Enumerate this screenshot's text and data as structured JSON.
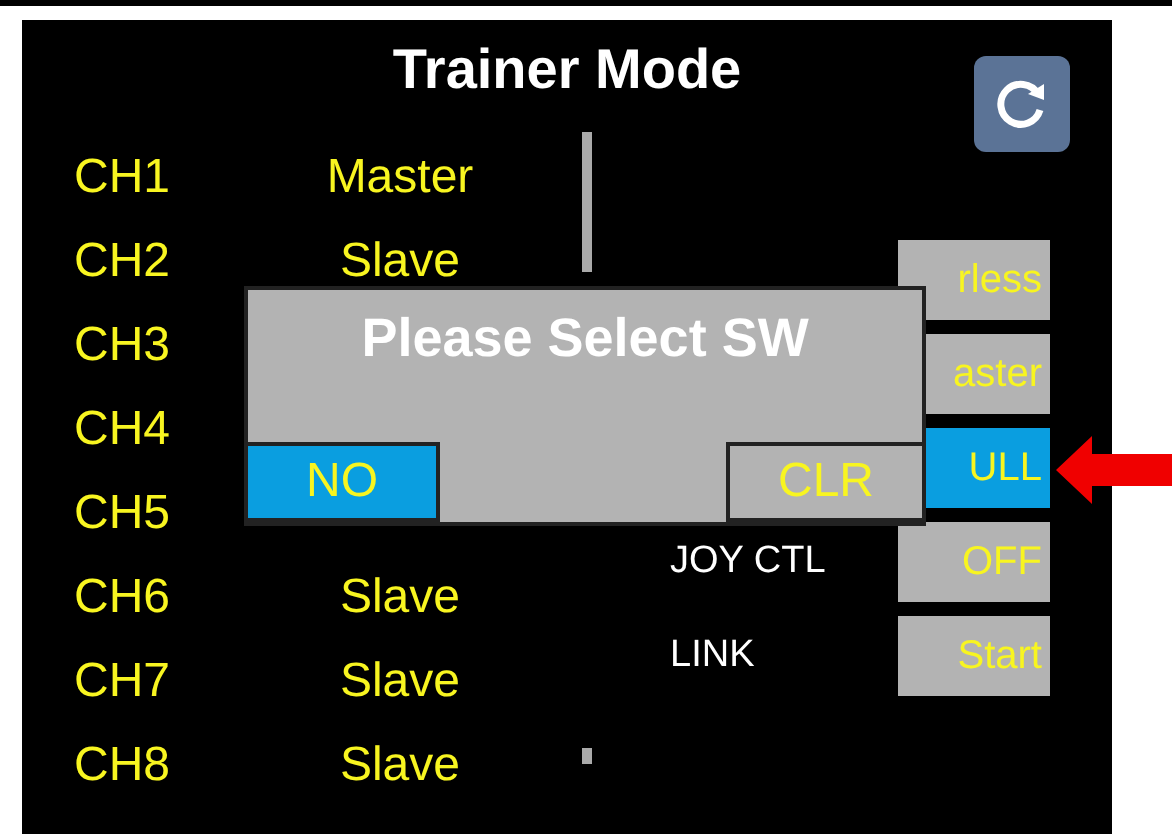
{
  "title": "Trainer Mode",
  "channels": [
    {
      "name": "CH1",
      "mode": "Master"
    },
    {
      "name": "CH2",
      "mode": "Slave"
    },
    {
      "name": "CH3"
    },
    {
      "name": "CH4"
    },
    {
      "name": "CH5"
    },
    {
      "name": "CH6",
      "mode": "Slave"
    },
    {
      "name": "CH7",
      "mode": "Slave"
    },
    {
      "name": "CH8",
      "mode": "Slave"
    }
  ],
  "settings": [
    {
      "value": "rless",
      "selected": false
    },
    {
      "value": "aster",
      "selected": false
    },
    {
      "value": "ULL",
      "selected": true
    },
    {
      "label": "JOY CTL",
      "value": "OFF",
      "selected": false
    },
    {
      "label": "LINK",
      "value": "Start",
      "selected": false
    }
  ],
  "dialog": {
    "title": "Please Select SW",
    "buttons": [
      {
        "label": "NO",
        "selected": true
      },
      {
        "label": "CLR",
        "selected": false
      }
    ]
  }
}
